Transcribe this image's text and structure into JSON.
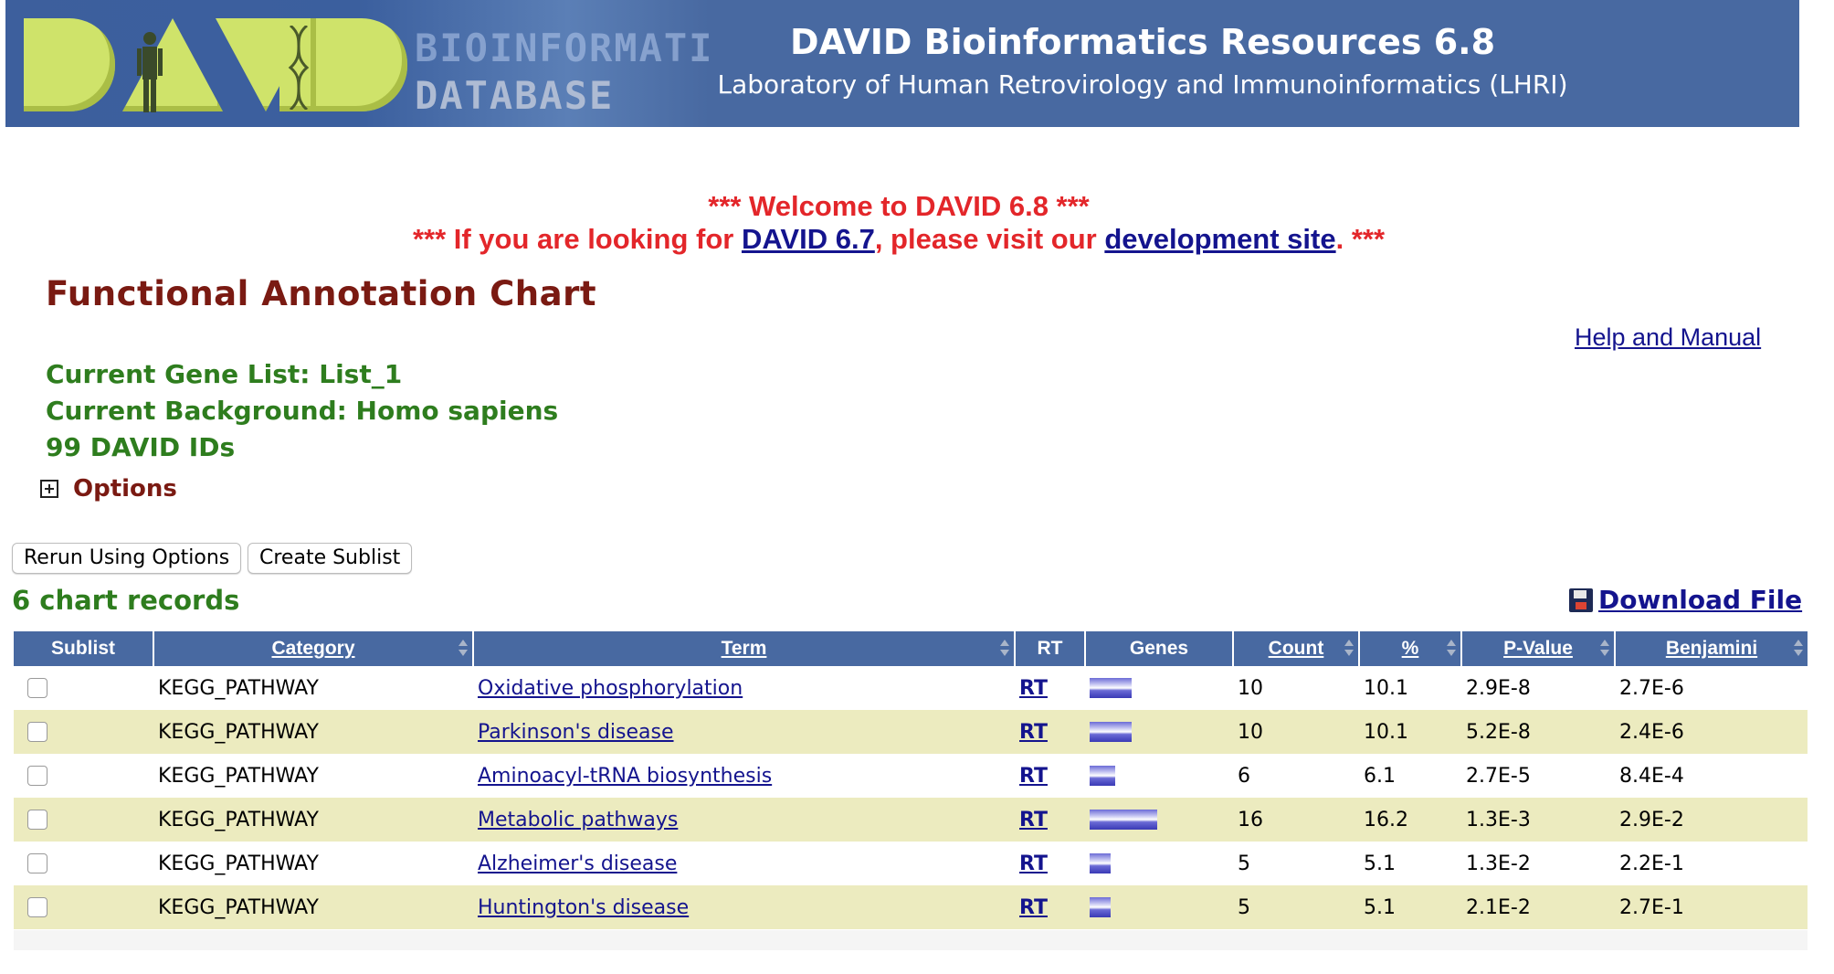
{
  "header": {
    "logo_word": "DAVID",
    "logo_sub1": "BIOINFORMATICS",
    "logo_sub2": "DATABASE",
    "title": "DAVID Bioinformatics Resources 6.8",
    "subtitle": "Laboratory of Human Retrovirology and Immunoinformatics (LHRI)"
  },
  "notice": {
    "welcome": "*** Welcome to DAVID 6.8 ***",
    "line2_prefix": "*** If you are looking for ",
    "line2_link1": "DAVID 6.7",
    "line2_middle": ", please visit our ",
    "line2_link2": "development site",
    "line2_suffix": ". ***"
  },
  "page": {
    "title": "Functional Annotation Chart",
    "help_link": "Help and Manual",
    "gene_list": "Current Gene List: List_1",
    "background": "Current Background: Homo sapiens",
    "ids": "99 DAVID IDs",
    "options_label": "Options",
    "rerun_button": "Rerun Using Options",
    "sublist_button": "Create Sublist",
    "records": "6 chart records",
    "download": "Download File"
  },
  "table": {
    "columns": [
      "Sublist",
      "Category",
      "Term",
      "RT",
      "Genes",
      "Count",
      "%",
      "P-Value",
      "Benjamini"
    ],
    "rows": [
      {
        "category": "KEGG_PATHWAY",
        "term": "Oxidative phosphorylation",
        "rt": "RT",
        "count": "10",
        "percent": "10.1",
        "pvalue": "2.9E-8",
        "benjamini": "2.7E-6",
        "genes_bar": 10
      },
      {
        "category": "KEGG_PATHWAY",
        "term": "Parkinson's disease",
        "rt": "RT",
        "count": "10",
        "percent": "10.1",
        "pvalue": "5.2E-8",
        "benjamini": "2.4E-6",
        "genes_bar": 10
      },
      {
        "category": "KEGG_PATHWAY",
        "term": "Aminoacyl-tRNA biosynthesis",
        "rt": "RT",
        "count": "6",
        "percent": "6.1",
        "pvalue": "2.7E-5",
        "benjamini": "8.4E-4",
        "genes_bar": 6
      },
      {
        "category": "KEGG_PATHWAY",
        "term": "Metabolic pathways",
        "rt": "RT",
        "count": "16",
        "percent": "16.2",
        "pvalue": "1.3E-3",
        "benjamini": "2.9E-2",
        "genes_bar": 16
      },
      {
        "category": "KEGG_PATHWAY",
        "term": "Alzheimer's disease",
        "rt": "RT",
        "count": "5",
        "percent": "5.1",
        "pvalue": "1.3E-2",
        "benjamini": "2.2E-1",
        "genes_bar": 5
      },
      {
        "category": "KEGG_PATHWAY",
        "term": "Huntington's disease",
        "rt": "RT",
        "count": "5",
        "percent": "5.1",
        "pvalue": "2.1E-2",
        "benjamini": "2.7E-1",
        "genes_bar": 5
      }
    ]
  }
}
